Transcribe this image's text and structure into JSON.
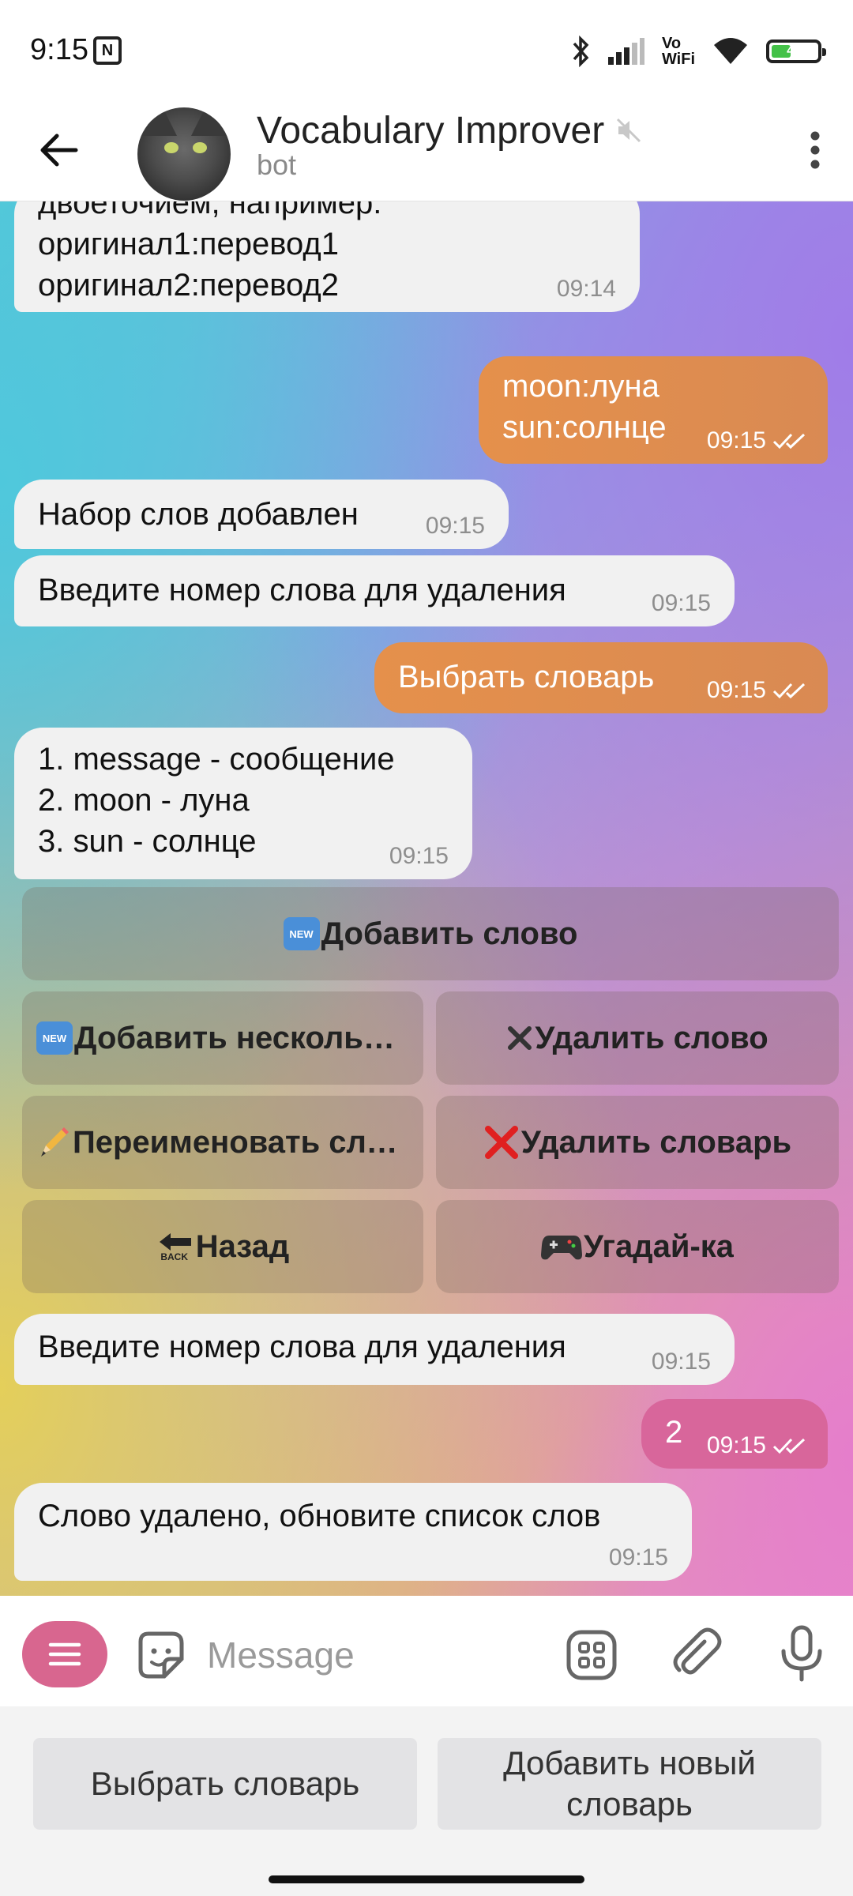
{
  "status_bar": {
    "time": "9:15",
    "battery_level": 0.42,
    "battery_text": "42",
    "icons": [
      "nfc-icon",
      "bluetooth-icon",
      "signal-icon",
      "vowifi-icon",
      "wifi-icon",
      "battery-icon"
    ],
    "vowifi_top": "Vo",
    "vowifi_bottom": "WiFi"
  },
  "header": {
    "title": "Vocabulary Improver",
    "subtitle": "bot",
    "muted": true
  },
  "messages": [
    {
      "type": "in",
      "text": "двоеточием, например:\nоригинал1:перевод1\nоригинал2:перевод2",
      "time": "09:14"
    },
    {
      "type": "out",
      "text": "moon:луна\nsun:солнце",
      "time": "09:15"
    },
    {
      "type": "in",
      "text": "Набор слов добавлен",
      "time": "09:15"
    },
    {
      "type": "in",
      "text": "Введите номер слова для удаления",
      "time": "09:15"
    },
    {
      "type": "out",
      "text": "Выбрать словарь",
      "time": "09:15"
    },
    {
      "type": "in",
      "text": "1. message - сообщение\n2. moon - луна\n3. sun - солнце",
      "time": "09:15"
    },
    {
      "type": "in",
      "text": "Введите номер слова для удаления",
      "time": "09:15"
    },
    {
      "type": "out",
      "text": "2",
      "time": "09:15"
    },
    {
      "type": "in",
      "text": "Слово удалено, обновите список слов",
      "time": "09:15"
    }
  ],
  "inline_keyboard": {
    "new_badge": "NEW",
    "back_badge": "BACK",
    "buttons": [
      {
        "label": "Добавить слово",
        "icon": "new-icon"
      },
      {
        "label": "Добавить нескольк…",
        "icon": "new-icon"
      },
      {
        "label": "Удалить слово",
        "icon": "heavy-x-icon"
      },
      {
        "label": "Переименовать сло…",
        "icon": "pencil-icon"
      },
      {
        "label": "Удалить словарь",
        "icon": "red-cross-icon"
      },
      {
        "label": "Назад",
        "icon": "back-arrow-icon"
      },
      {
        "label": "Угадай-ка",
        "icon": "gamepad-icon"
      }
    ]
  },
  "input": {
    "placeholder": "Message"
  },
  "reply_keyboard": {
    "buttons": [
      "Выбрать словарь",
      "Добавить новый\nсловарь"
    ]
  },
  "colors": {
    "outgoing_bubble": "#e08d4e",
    "outgoing_bubble_pink": "#d8669b",
    "incoming_bubble": "#f1f1f1",
    "accent": "#d8668f"
  }
}
